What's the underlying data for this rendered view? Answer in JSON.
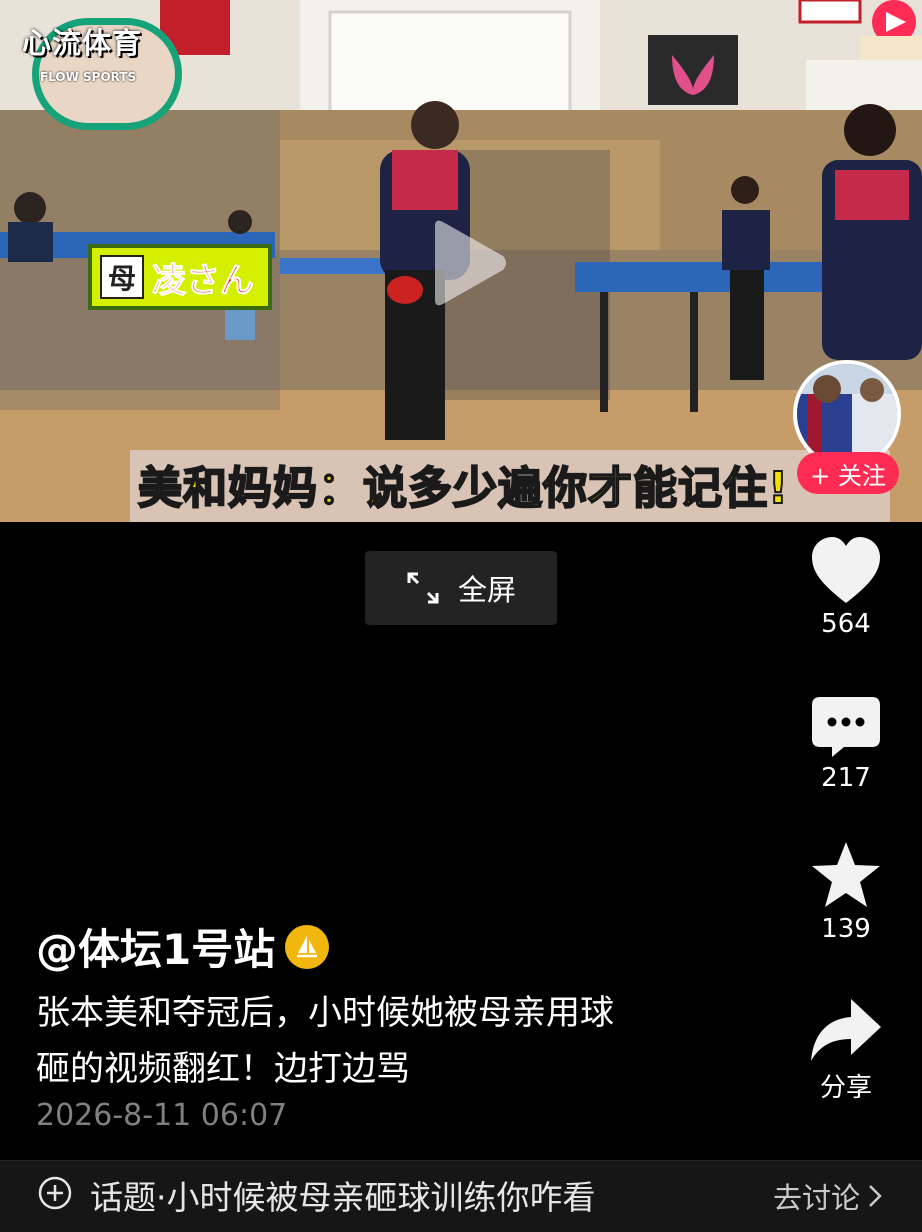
{
  "video": {
    "watermark_title": "心流体育",
    "watermark_sub": "FLOW SPORTS",
    "name_tag_prefix": "母",
    "name_tag_name": "凌さん",
    "subtitle": "美和妈妈：说多少遍你才能记住!",
    "follow_label": "+ 关注"
  },
  "fullscreen": {
    "label": "全屏"
  },
  "actions": {
    "likes": "564",
    "comments": "217",
    "favorites": "139",
    "share_label": "分享"
  },
  "post": {
    "author": "@体坛1号站",
    "description_line1": "张本美和夺冠后，小时候她被母亲用球",
    "description_line2": "砸的视频翻红！边打边骂",
    "date": "2026-8-11 06:07"
  },
  "topic_bar": {
    "topic": "话题·小时候被母亲砸球训练你咋看",
    "discuss": "去讨论"
  },
  "colors": {
    "follow": "#fe2c55",
    "subtitle": "#f6e200",
    "background": "#000000"
  }
}
